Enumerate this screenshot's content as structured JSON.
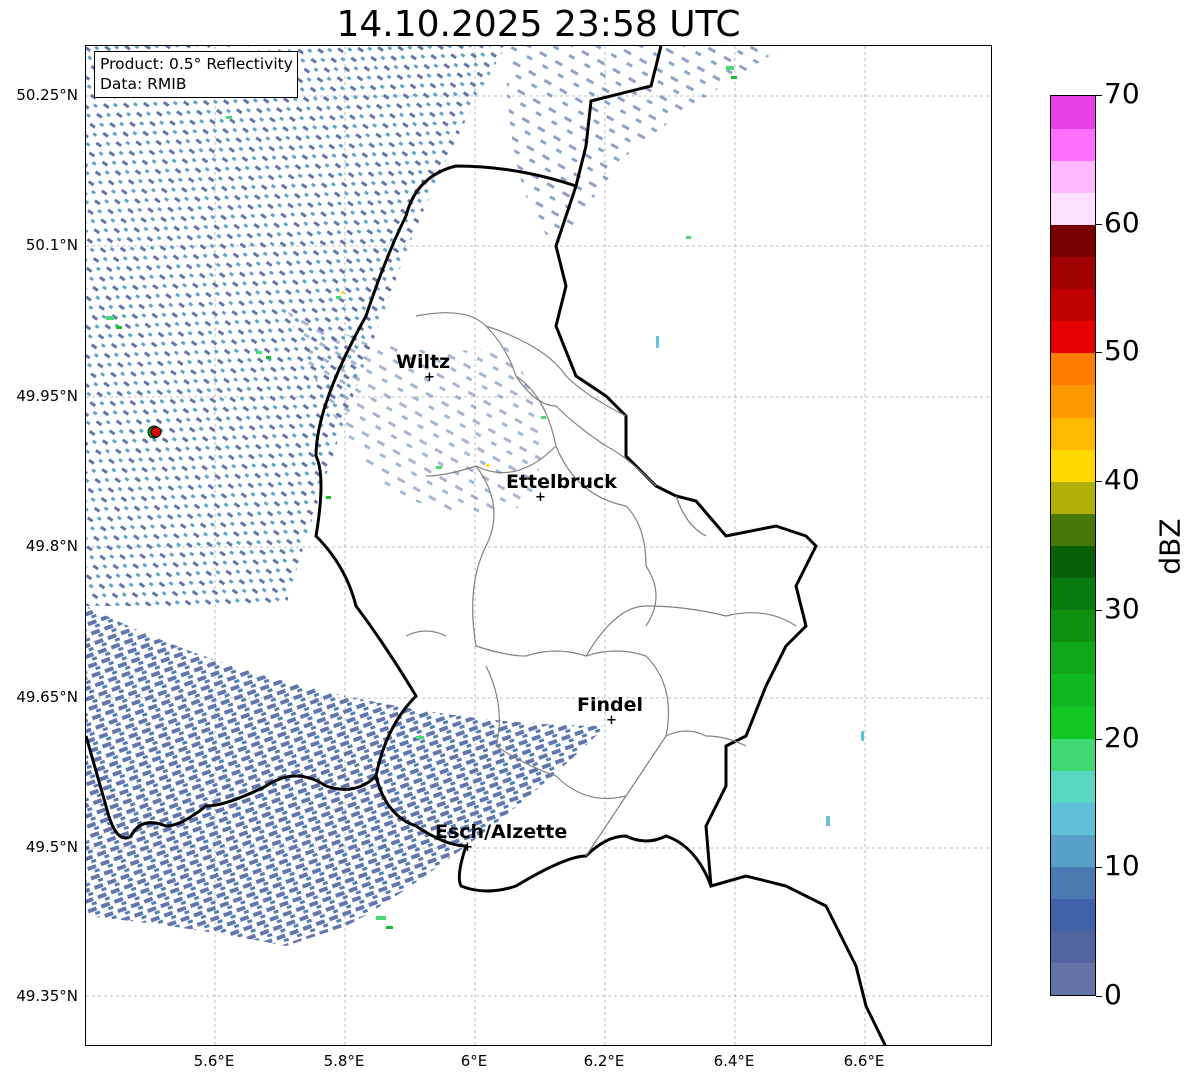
{
  "title": "14.10.2025 23:58 UTC",
  "info": {
    "product": "Product: 0.5° Reflectivity",
    "source": "Data: RMIB"
  },
  "lat_labels": [
    "50.25°N",
    "50.1°N",
    "49.95°N",
    "49.8°N",
    "49.65°N",
    "49.5°N",
    "49.35°N"
  ],
  "lon_labels": [
    "5.6°E",
    "5.8°E",
    "6°E",
    "6.2°E",
    "6.4°E",
    "6.6°E"
  ],
  "cities": [
    {
      "name": "Wiltz"
    },
    {
      "name": "Ettelbruck"
    },
    {
      "name": "Findel"
    },
    {
      "name": "Esch/Alzette"
    }
  ],
  "colorbar": {
    "label": "dBZ",
    "ticks": [
      "0",
      "10",
      "20",
      "30",
      "40",
      "50",
      "60",
      "70"
    ],
    "colors": [
      "#6474a8",
      "#5064a0",
      "#4060a8",
      "#4a78b0",
      "#58a0c8",
      "#60c0d8",
      "#58d8c0",
      "#40d870",
      "#10c820",
      "#10b820",
      "#10a818",
      "#109010",
      "#087c10",
      "#086008",
      "#487808",
      "#b0b008",
      "#ffd800",
      "#ffb800",
      "#ff9800",
      "#ff7c00",
      "#e80000",
      "#c00000",
      "#a00000",
      "#780000",
      "#ffe0ff",
      "#ffb8ff",
      "#ff70ff",
      "#e840e8"
    ]
  },
  "radar": {
    "name": "radar-site",
    "color": "#e00000"
  }
}
